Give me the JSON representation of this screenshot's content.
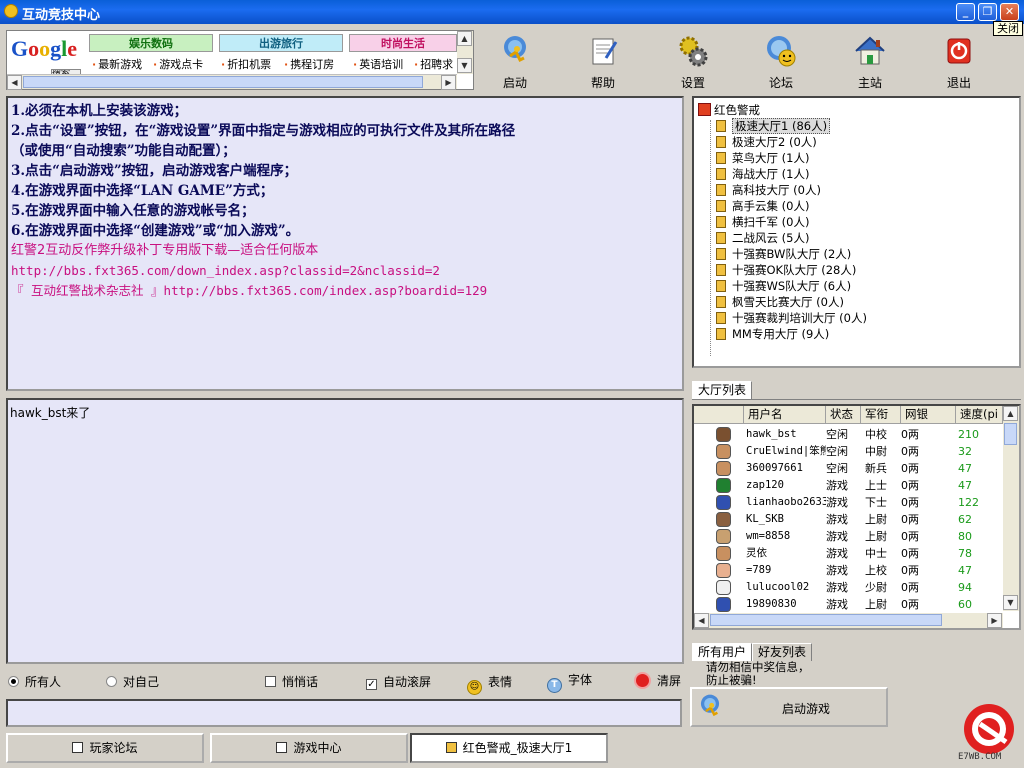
{
  "window": {
    "title": "互动竞技中心",
    "close_tooltip": "关闭"
  },
  "ad": {
    "tabs": [
      {
        "label": "娱乐数码",
        "color": "#c8f0c0"
      },
      {
        "label": "出游旅行",
        "color": "#c0ecf8"
      },
      {
        "label": "时尚生活",
        "color": "#f8d0e8"
      }
    ],
    "links": [
      "最新游戏",
      "游戏点卡",
      "折扣机票",
      "携程订房",
      "英语培训",
      "招聘求"
    ],
    "google_button": "搜索"
  },
  "toolbar": [
    {
      "label": "启动",
      "icon": "runner-icon"
    },
    {
      "label": "帮助",
      "icon": "help-doc-icon"
    },
    {
      "label": "设置",
      "icon": "gears-icon"
    },
    {
      "label": "论坛",
      "icon": "forum-globe-icon"
    },
    {
      "label": "主站",
      "icon": "home-icon"
    },
    {
      "label": "退出",
      "icon": "power-icon"
    }
  ],
  "notice": {
    "instructions": [
      "1.必须在本机上安装该游戏；",
      "2.点击“设置”按钮，在“游戏设置”界面中指定与游戏相应的可执行文件及其所在路径",
      "（或使用“自动搜索”功能自动配置）；",
      "3.点击“启动游戏”按钮，启动游戏客户端程序；",
      "4.在游戏界面中选择“LAN GAME”方式；",
      "5.在游戏界面中输入任意的游戏帐号名；",
      "6.在游戏界面中选择“创建游戏”或“加入游戏”。"
    ],
    "links": [
      "红警2互动反作弊升级补丁专用版下载—适合任何版本",
      "http://bbs.fxt365.com/down_index.asp?classid=2&nclassid=2",
      "『 互动红警战术杂志社 』http://bbs.fxt365.com/index.asp?boardid=129"
    ]
  },
  "chat": {
    "messages": [
      "hawk_bst来了"
    ]
  },
  "tree": {
    "root": "红色警戒",
    "rooms": [
      "极速大厅1 (86人)",
      "极速大厅2 (0人)",
      "菜鸟大厅 (1人)",
      "海战大厅 (1人)",
      "高科技大厅 (0人)",
      "高手云集 (0人)",
      "横扫千军 (0人)",
      "二战风云 (5人)",
      "十强赛BW队大厅 (2人)",
      "十强赛OK队大厅 (28人)",
      "十强赛WS队大厅 (6人)",
      "枫雪天比赛大厅 (0人)",
      "十强赛裁判培训大厅 (0人)",
      "MM专用大厅 (9人)"
    ],
    "selected_index": 0,
    "tab_label": "大厅列表"
  },
  "users": {
    "columns": [
      "用户名",
      "状态",
      "军衔",
      "网银",
      "速度(pi"
    ],
    "rows": [
      {
        "name": "hawk_bst",
        "status": "空闲",
        "rank": "中校",
        "money": "0两",
        "speed": "210",
        "avatar": "#7a5030"
      },
      {
        "name": "CruElwind|笨熊",
        "status": "空闲",
        "rank": "中尉",
        "money": "0两",
        "speed": "32",
        "avatar": "#c89060"
      },
      {
        "name": "360097661",
        "status": "空闲",
        "rank": "新兵",
        "money": "0两",
        "speed": "47",
        "avatar": "#c89060"
      },
      {
        "name": "zap120",
        "status": "游戏",
        "rank": "上士",
        "money": "0两",
        "speed": "47",
        "avatar": "#208030"
      },
      {
        "name": "lianhaobo2633",
        "status": "游戏",
        "rank": "下士",
        "money": "0两",
        "speed": "122",
        "avatar": "#3050b0"
      },
      {
        "name": "KL_SKB",
        "status": "游戏",
        "rank": "上尉",
        "money": "0两",
        "speed": "62",
        "avatar": "#8a6040"
      },
      {
        "name": "wm=8858",
        "status": "游戏",
        "rank": "上尉",
        "money": "0两",
        "speed": "80",
        "avatar": "#c8a070"
      },
      {
        "name": "灵依",
        "status": "游戏",
        "rank": "中士",
        "money": "0两",
        "speed": "78",
        "avatar": "#c89060"
      },
      {
        "name": "=789",
        "status": "游戏",
        "rank": "上校",
        "money": "0两",
        "speed": "47",
        "avatar": "#e8b090"
      },
      {
        "name": "lulucool02",
        "status": "游戏",
        "rank": "少尉",
        "money": "0两",
        "speed": "94",
        "avatar": "#f0f0f0"
      },
      {
        "name": "19890830",
        "status": "游戏",
        "rank": "上尉",
        "money": "0两",
        "speed": "60",
        "avatar": "#3050b0"
      }
    ],
    "tabs": [
      "所有用户",
      "好友列表"
    ]
  },
  "controls": {
    "radio_all": "所有人",
    "radio_self": "对自己",
    "whisper": "悄悄话",
    "autoscroll": "自动滚屏",
    "emote": "表情",
    "font": "字体",
    "clear": "清屏"
  },
  "warning": "请勿相信中奖信息，防止被骗!",
  "start_button": "启动游戏",
  "taskbar": [
    "玩家论坛",
    "游戏中心",
    "红色警戒_极速大厅1"
  ],
  "logo_text": "E7WB.COM"
}
